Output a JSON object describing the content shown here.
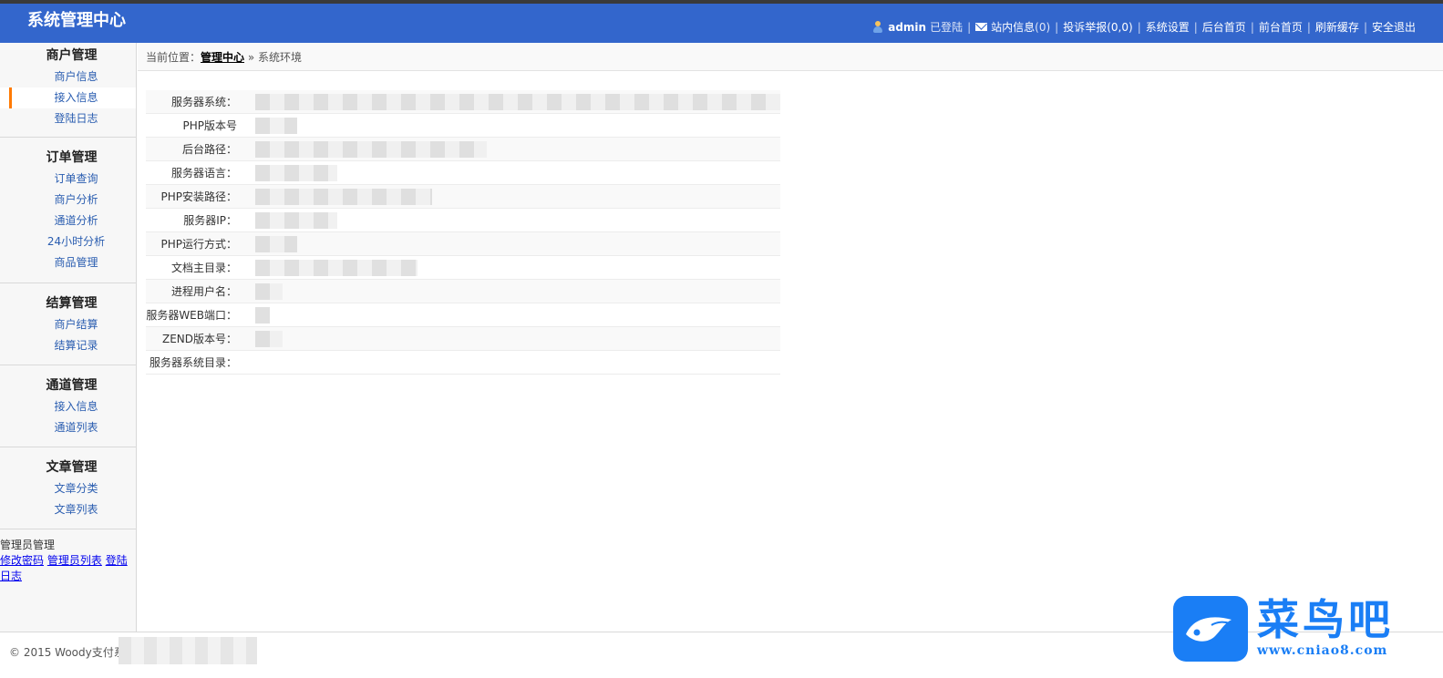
{
  "header": {
    "title": "系统管理中心",
    "username": "admin",
    "logged_in": "已登陆",
    "messages_label": "站内信息",
    "messages_count": "(0)",
    "complaints_label": "投诉举报",
    "complaints_count": "(0,0)",
    "links": [
      "系统设置",
      "后台首页",
      "前台首页",
      "刷新缓存",
      "安全退出"
    ]
  },
  "sidebar": {
    "groups": [
      {
        "title": "商户管理",
        "items": [
          "商户信息",
          "接入信息",
          "登陆日志"
        ]
      },
      {
        "title": "订单管理",
        "items": [
          "订单查询",
          "商户分析",
          "通道分析",
          "24小时分析",
          "商品管理"
        ]
      },
      {
        "title": "结算管理",
        "items": [
          "商户结算",
          "结算记录"
        ]
      },
      {
        "title": "通道管理",
        "items": [
          "接入信息",
          "通道列表"
        ]
      },
      {
        "title": "文章管理",
        "items": [
          "文章分类",
          "文章列表"
        ]
      },
      {
        "title": "管理员管理",
        "items": [
          "修改密码",
          "管理员列表",
          "登陆日志"
        ]
      }
    ]
  },
  "breadcrumb": {
    "prefix": "当前位置：",
    "link": "管理中心",
    "sep": "»",
    "current": "系统环境"
  },
  "info": {
    "rows": [
      {
        "label": "服务器系统："
      },
      {
        "label": "PHP版本号"
      },
      {
        "label": "后台路径："
      },
      {
        "label": "服务器语言："
      },
      {
        "label": "PHP安装路径："
      },
      {
        "label": "服务器IP："
      },
      {
        "label": "PHP运行方式："
      },
      {
        "label": "文档主目录："
      },
      {
        "label": "进程用户名："
      },
      {
        "label": "服务器WEB端口："
      },
      {
        "label": "ZEND版本号："
      },
      {
        "label": "服务器系统目录："
      }
    ]
  },
  "footer": {
    "copyright": "© 2015 Woody支付系"
  },
  "watermark": {
    "cn": "菜鸟吧",
    "url": "www.cniao8.com",
    "color": "#1a7ef5"
  }
}
